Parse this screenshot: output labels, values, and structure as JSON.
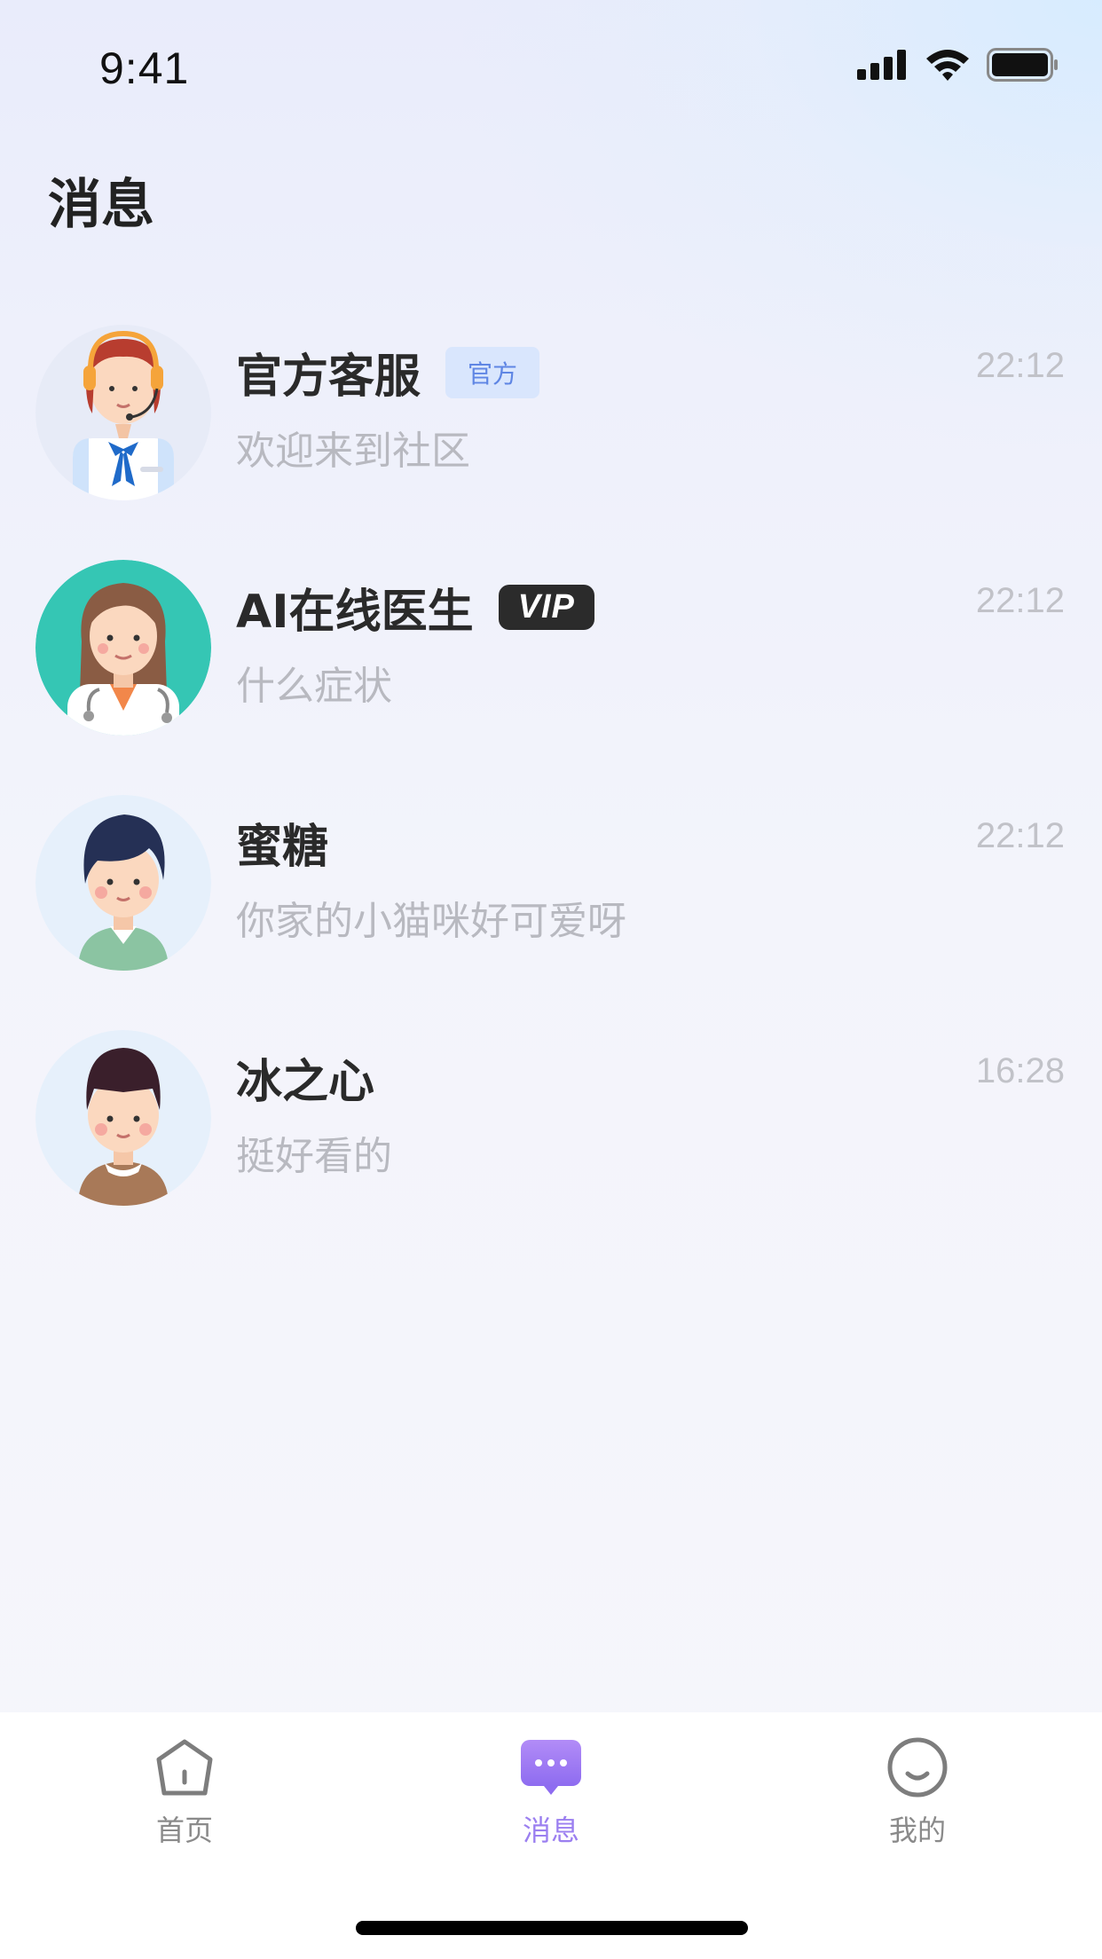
{
  "status_bar": {
    "time": "9:41"
  },
  "header": {
    "title": "消息"
  },
  "messages": [
    {
      "name": "官方客服",
      "badge": "官方",
      "preview": "欢迎来到社区",
      "time": "22:12"
    },
    {
      "name": "AI在线医生",
      "badge": "VIP",
      "preview": "什么症状",
      "time": "22:12"
    },
    {
      "name": "蜜糖",
      "preview": "你家的小猫咪好可爱呀",
      "time": "22:12"
    },
    {
      "name": "冰之心",
      "preview": "挺好看的",
      "time": "16:28"
    }
  ],
  "tab_bar": {
    "tabs": [
      {
        "label": "首页",
        "icon": "home-icon",
        "active": false
      },
      {
        "label": "消息",
        "icon": "message-icon",
        "active": true
      },
      {
        "label": "我的",
        "icon": "smile-icon",
        "active": false
      }
    ]
  },
  "colors": {
    "accent": "#9b7ff0",
    "official_badge_bg": "#d9e6fd",
    "vip_badge_bg": "#2b2b2b"
  }
}
